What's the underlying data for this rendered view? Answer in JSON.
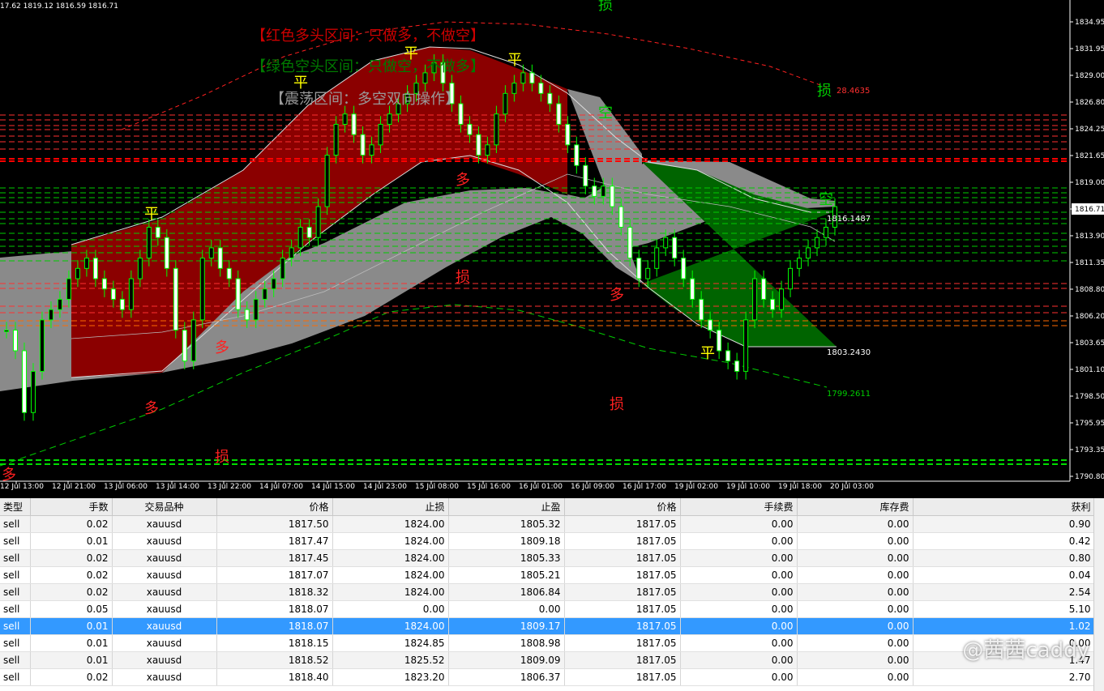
{
  "chart": {
    "ohlc_header": "17.62 1819.12 1816.59 1816.71",
    "price_scale": [
      "1834.95",
      "1831.95",
      "1829.00",
      "1826.80",
      "1824.25",
      "1821.65",
      "1819.00",
      "1816.71",
      "1813.90",
      "1811.35",
      "1808.80",
      "1806.20",
      "1803.65",
      "1801.10",
      "1798.50",
      "1795.95",
      "1793.35",
      "1790.80"
    ],
    "current_price": "1816.71",
    "time_axis": [
      "12 Jul 13:00",
      "12 Jul 21:00",
      "13 Jul 06:00",
      "13 Jul 14:00",
      "13 Jul 22:00",
      "14 Jul 07:00",
      "14 Jul 15:00",
      "14 Jul 23:00",
      "15 Jul 08:00",
      "15 Jul 16:00",
      "16 Jul 01:00",
      "16 Jul 09:00",
      "16 Jul 17:00",
      "19 Jul 02:00",
      "19 Jul 10:00",
      "19 Jul 18:00",
      "20 Jul 03:00"
    ],
    "annotations": {
      "red_zone": "【红色多头区间：只做多，不做空】",
      "green_zone": "【绿色空头区间：只做空，不做多】",
      "range_zone": "【震荡区间：多空双向操作】"
    },
    "level_labels": {
      "tp_upper": "28.4635",
      "mid": "1816.1487",
      "lower": "1803.2430",
      "sl_lower": "1799.2611"
    },
    "colors": {
      "bull_zone": "#8b0000",
      "bear_zone": "#006400",
      "range_zone": "#8a8a8a",
      "candle": "#00ff00",
      "long_mark": "#ff0000",
      "flat_mark": "#ffff00",
      "stop_mark_green": "#00cc00"
    },
    "marks": [
      {
        "text": "多",
        "color": "red"
      },
      {
        "text": "多",
        "color": "red"
      },
      {
        "text": "平",
        "color": "yellow"
      },
      {
        "text": "多",
        "color": "red"
      },
      {
        "text": "损",
        "color": "red"
      },
      {
        "text": "平",
        "color": "yellow"
      },
      {
        "text": "平",
        "color": "yellow"
      },
      {
        "text": "平",
        "color": "yellow"
      },
      {
        "text": "多",
        "color": "red"
      },
      {
        "text": "损",
        "color": "red"
      },
      {
        "text": "空",
        "color": "green"
      },
      {
        "text": "多",
        "color": "red"
      },
      {
        "text": "损",
        "color": "red"
      },
      {
        "text": "损",
        "color": "green"
      },
      {
        "text": "平",
        "color": "yellow"
      },
      {
        "text": "空",
        "color": "green"
      },
      {
        "text": "损",
        "color": "green"
      }
    ]
  },
  "terminal": {
    "columns": [
      "类型",
      "手数",
      "交易品种",
      "价格",
      "止损",
      "止盈",
      "价格",
      "手续费",
      "库存费",
      "获利"
    ],
    "rows": [
      [
        "sell",
        "0.02",
        "xauusd",
        "1817.50",
        "1824.00",
        "1805.32",
        "1817.05",
        "0.00",
        "0.00",
        "0.90"
      ],
      [
        "sell",
        "0.01",
        "xauusd",
        "1817.47",
        "1824.00",
        "1809.18",
        "1817.05",
        "0.00",
        "0.00",
        "0.42"
      ],
      [
        "sell",
        "0.02",
        "xauusd",
        "1817.45",
        "1824.00",
        "1805.33",
        "1817.05",
        "0.00",
        "0.00",
        "0.80"
      ],
      [
        "sell",
        "0.02",
        "xauusd",
        "1817.07",
        "1824.00",
        "1805.21",
        "1817.05",
        "0.00",
        "0.00",
        "0.04"
      ],
      [
        "sell",
        "0.02",
        "xauusd",
        "1818.32",
        "1824.00",
        "1806.84",
        "1817.05",
        "0.00",
        "0.00",
        "2.54"
      ],
      [
        "sell",
        "0.05",
        "xauusd",
        "1818.07",
        "0.00",
        "0.00",
        "1817.05",
        "0.00",
        "0.00",
        "5.10"
      ],
      [
        "sell",
        "0.01",
        "xauusd",
        "1818.07",
        "1824.00",
        "1809.17",
        "1817.05",
        "0.00",
        "0.00",
        "1.02"
      ],
      [
        "sell",
        "0.01",
        "xauusd",
        "1818.15",
        "1824.85",
        "1808.98",
        "1817.05",
        "0.00",
        "0.00",
        "0.00"
      ],
      [
        "sell",
        "0.01",
        "xauusd",
        "1818.52",
        "1825.52",
        "1809.09",
        "1817.05",
        "0.00",
        "0.00",
        "1.47"
      ],
      [
        "sell",
        "0.02",
        "xauusd",
        "1818.40",
        "1823.20",
        "1806.37",
        "1817.05",
        "0.00",
        "0.00",
        "2.70"
      ]
    ],
    "selected_row": 6
  },
  "watermark": "@茜茜caddy"
}
